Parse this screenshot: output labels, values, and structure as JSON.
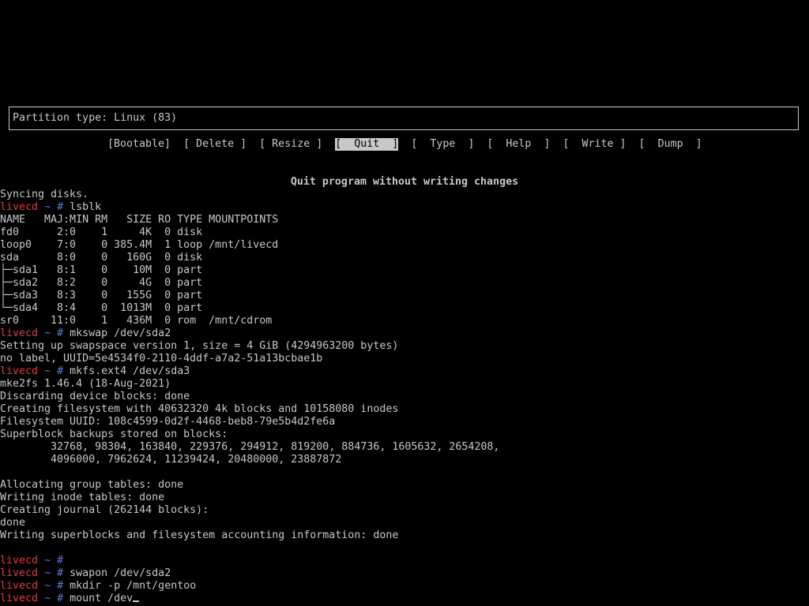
{
  "cfdisk": {
    "partition_type": "Partition type: Linux (83)",
    "menu": [
      {
        "label": "[Bootable]",
        "selected": false
      },
      {
        "label": "[ Delete ]",
        "selected": false
      },
      {
        "label": "[ Resize ]",
        "selected": false
      },
      {
        "label": "[  Quit  ]",
        "selected": true
      },
      {
        "label": "[  Type  ]",
        "selected": false
      },
      {
        "label": "[  Help  ]",
        "selected": false
      },
      {
        "label": "[  Write ]",
        "selected": false
      },
      {
        "label": "[  Dump  ]",
        "selected": false
      }
    ],
    "hint": "Quit program without writing changes"
  },
  "prompt": {
    "host": "livecd",
    "symbol": "~ #"
  },
  "terminal_lines": [
    {
      "text": "Syncing disks."
    },
    {
      "prompt": true,
      "cmd": "lsblk"
    },
    {
      "text": "NAME   MAJ:MIN RM   SIZE RO TYPE MOUNTPOINTS"
    },
    {
      "text": "fd0      2:0    1     4K  0 disk"
    },
    {
      "text": "loop0    7:0    0 385.4M  1 loop /mnt/livecd"
    },
    {
      "text": "sda      8:0    0   160G  0 disk"
    },
    {
      "text": "├─sda1   8:1    0    10M  0 part"
    },
    {
      "text": "├─sda2   8:2    0     4G  0 part"
    },
    {
      "text": "├─sda3   8:3    0   155G  0 part"
    },
    {
      "text": "└─sda4   8:4    0  1013M  0 part"
    },
    {
      "text": "sr0     11:0    1   436M  0 rom  /mnt/cdrom"
    },
    {
      "prompt": true,
      "cmd": "mkswap /dev/sda2"
    },
    {
      "text": "Setting up swapspace version 1, size = 4 GiB (4294963200 bytes)"
    },
    {
      "text": "no label, UUID=5e4534f0-2110-4ddf-a7a2-51a13bcbae1b"
    },
    {
      "prompt": true,
      "cmd": "mkfs.ext4 /dev/sda3"
    },
    {
      "text": "mke2fs 1.46.4 (18-Aug-2021)"
    },
    {
      "text": "Discarding device blocks: done"
    },
    {
      "text": "Creating filesystem with 40632320 4k blocks and 10158080 inodes"
    },
    {
      "text": "Filesystem UUID: 108c4599-0d2f-4468-beb8-79e5b4d2fe6a"
    },
    {
      "text": "Superblock backups stored on blocks:"
    },
    {
      "text": "        32768, 98304, 163840, 229376, 294912, 819200, 884736, 1605632, 2654208,"
    },
    {
      "text": "        4096000, 7962624, 11239424, 20480000, 23887872"
    },
    {
      "text": ""
    },
    {
      "text": "Allocating group tables: done"
    },
    {
      "text": "Writing inode tables: done"
    },
    {
      "text": "Creating journal (262144 blocks):"
    },
    {
      "text": "done"
    },
    {
      "text": "Writing superblocks and filesystem accounting information: done"
    },
    {
      "text": ""
    },
    {
      "prompt": true,
      "cmd": ""
    },
    {
      "prompt": true,
      "cmd": "swapon /dev/sda2"
    },
    {
      "prompt": true,
      "cmd": "mkdir -p /mnt/gentoo"
    },
    {
      "prompt": true,
      "cmd": "mount /dev",
      "cursor": true
    }
  ]
}
